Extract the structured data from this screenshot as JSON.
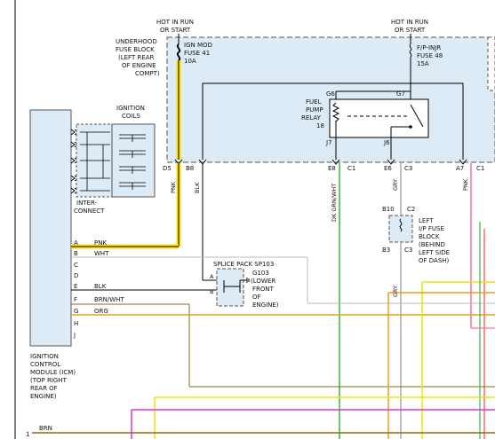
{
  "hot_left": {
    "line1": "HOT IN RUN",
    "line2": "OR START"
  },
  "hot_right": {
    "line1": "HOT IN RUN",
    "line2": "OR START"
  },
  "underhood": {
    "l1": "UNDERHOOD",
    "l2": "FUSE BLOCK",
    "l3": "(LEFT REAR",
    "l4": "OF ENGINE",
    "l5": "COMPT)"
  },
  "fuse41": {
    "l1": "IGN MOD",
    "l2": "FUSE 41",
    "l3": "10A"
  },
  "fuse48": {
    "l1": "F/P-INJR",
    "l2": "FUSE 48",
    "l3": "15A"
  },
  "relay": {
    "l1": "FUEL",
    "l2": "PUMP",
    "l3": "RELAY",
    "l4": "18",
    "g6": "G6",
    "g7": "G7",
    "j7": "J7",
    "j6": "J6"
  },
  "coils": {
    "l1": "IGNITION",
    "l2": "COILS"
  },
  "interconnect": {
    "l1": "INTER-",
    "l2": "CONNECT"
  },
  "connectors": {
    "d5": "D5",
    "b8": "B8",
    "e8": "E8",
    "c1a": "C1",
    "e6": "E6",
    "c3a": "C3",
    "a7": "A7",
    "c1b": "C1"
  },
  "vertical_wires": {
    "pnk1": "PNK",
    "blk": "BLK",
    "dkgrnwht": "DK GRN/WHT",
    "gry1": "GRY",
    "pnk2": "PNK",
    "gry2": "GRY"
  },
  "ip_fuse": {
    "b10": "B10",
    "c2": "C2",
    "b3": "B3",
    "c3": "C3",
    "l1": "LEFT",
    "l2": "I/P FUSE",
    "l3": "BLOCK",
    "l4": "(BEHIND",
    "l5": "LEFT SIDE",
    "l6": "OF DASH)"
  },
  "splice": {
    "title": "SPLICE PACK SP103",
    "pin_a": "A",
    "pin_b": "B",
    "g103_l1": "G103",
    "g103_l2": "(LOWER",
    "g103_l3": "FRONT",
    "g103_l4": "OF",
    "g103_l5": "ENGINE)"
  },
  "icm_pins": [
    {
      "pin": "A",
      "wire": "PNK"
    },
    {
      "pin": "B",
      "wire": "WHT"
    },
    {
      "pin": "C",
      "wire": ""
    },
    {
      "pin": "D",
      "wire": ""
    },
    {
      "pin": "E",
      "wire": "BLK"
    },
    {
      "pin": "F",
      "wire": "BRN/WHT"
    },
    {
      "pin": "G",
      "wire": "ORG"
    },
    {
      "pin": "H",
      "wire": ""
    },
    {
      "pin": "J",
      "wire": ""
    }
  ],
  "icm": {
    "l1": "IGNITION",
    "l2": "CONTROL",
    "l3": "MODULE (ICM)",
    "l4": "(TOP RIGHT",
    "l5": "REAR OF",
    "l6": "ENGINE)"
  },
  "bottom": {
    "num": "1",
    "wire": "BRN"
  },
  "colors": {
    "fuse_block_fill": "#dcebf6",
    "highlight": "#ffe000",
    "pink": "#ff6fa0",
    "green": "#33bb33",
    "gray": "#aaaaaa",
    "orange": "#e6a020",
    "brown": "#8b6b14",
    "magenta": "#dd33dd",
    "yellow": "#e8e800",
    "red": "#ff4444"
  }
}
